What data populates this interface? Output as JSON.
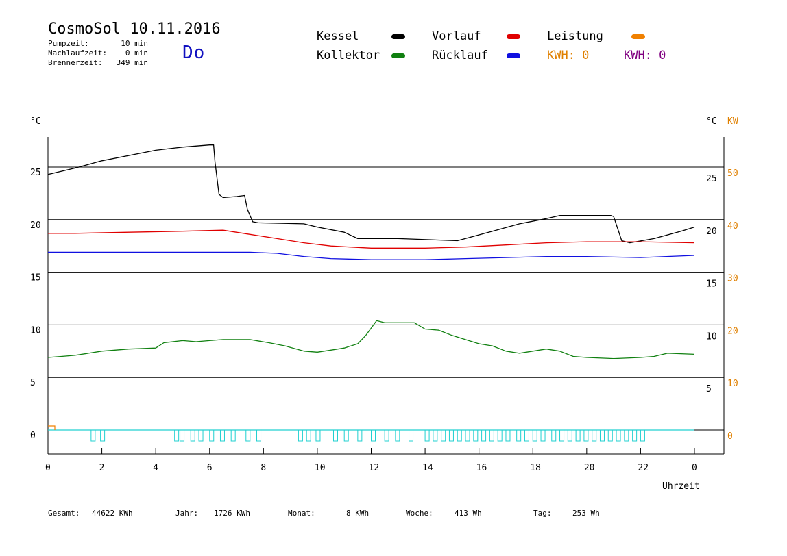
{
  "header": {
    "title": "CosmoSol 10.11.2016",
    "weekday": "Do",
    "stats": [
      {
        "label": "Pumpzeit:",
        "value": "10 min"
      },
      {
        "label": "Nachlaufzeit:",
        "value": "0 min"
      },
      {
        "label": "Brennerzeit:",
        "value": "349 min"
      }
    ]
  },
  "legend": {
    "kessel": {
      "label": "Kessel",
      "color": "#000000"
    },
    "vorlauf": {
      "label": "Vorlauf",
      "color": "#e00000"
    },
    "leistung": {
      "label": "Leistung",
      "color": "#f08000"
    },
    "kollektor": {
      "label": "Kollektor",
      "color": "#108010"
    },
    "ruecklauf": {
      "label": "Rücklauf",
      "color": "#1010e0"
    },
    "kwh1": {
      "label": "KWH: 0",
      "color": "#e08000"
    },
    "kwh2": {
      "label": "KWH: 0",
      "color": "#800080"
    }
  },
  "footer": [
    {
      "label": "Gesamt:",
      "value": "44622 KWh"
    },
    {
      "label": "Jahr:",
      "value": "1726 KWh"
    },
    {
      "label": "Monat:",
      "value": "8 KWh"
    },
    {
      "label": "Woche:",
      "value": "413 Wh"
    },
    {
      "label": "Tag:",
      "value": "253 Wh"
    }
  ],
  "chart_data": {
    "type": "line",
    "xlabel": "Uhrzeit",
    "x_ticks": [
      "0",
      "2",
      "4",
      "6",
      "8",
      "10",
      "12",
      "14",
      "16",
      "18",
      "20",
      "22",
      "0"
    ],
    "xlim": [
      0,
      24
    ],
    "left_axis": {
      "unit": "°C",
      "ticks": [
        0,
        5,
        10,
        15,
        20,
        25
      ],
      "ylim": [
        -2,
        28
      ]
    },
    "right_axis_temp": {
      "unit": "°C",
      "ticks": [
        5,
        10,
        15,
        20,
        25
      ]
    },
    "right_axis_power": {
      "unit": "KW",
      "ticks": [
        0,
        10,
        20,
        30,
        40,
        50
      ],
      "color": "#e08000"
    },
    "grid": "horizontal",
    "series": [
      {
        "name": "Kessel",
        "color": "#000000",
        "points": [
          [
            0,
            24.3
          ],
          [
            1,
            24.9
          ],
          [
            2,
            25.6
          ],
          [
            3,
            26.1
          ],
          [
            4,
            26.6
          ],
          [
            5,
            26.9
          ],
          [
            6,
            27.1
          ],
          [
            6.15,
            27.1
          ],
          [
            6.2,
            25.5
          ],
          [
            6.35,
            22.4
          ],
          [
            6.5,
            22.1
          ],
          [
            7.0,
            22.2
          ],
          [
            7.3,
            22.3
          ],
          [
            7.4,
            21.0
          ],
          [
            7.6,
            19.8
          ],
          [
            7.8,
            19.7
          ],
          [
            9.5,
            19.6
          ],
          [
            10.0,
            19.3
          ],
          [
            11.0,
            18.8
          ],
          [
            11.5,
            18.2
          ],
          [
            13.0,
            18.2
          ],
          [
            15.2,
            18.0
          ],
          [
            16.5,
            18.9
          ],
          [
            17.5,
            19.6
          ],
          [
            18.5,
            20.1
          ],
          [
            19.0,
            20.4
          ],
          [
            20.9,
            20.4
          ],
          [
            21.0,
            20.3
          ],
          [
            21.3,
            18.0
          ],
          [
            21.6,
            17.8
          ],
          [
            22.5,
            18.2
          ],
          [
            23.5,
            18.9
          ],
          [
            24,
            19.3
          ]
        ]
      },
      {
        "name": "Vorlauf",
        "color": "#e00000",
        "points": [
          [
            0,
            18.7
          ],
          [
            1,
            18.7
          ],
          [
            3,
            18.8
          ],
          [
            5,
            18.9
          ],
          [
            6.5,
            19.0
          ],
          [
            7.5,
            18.6
          ],
          [
            8.5,
            18.2
          ],
          [
            9.5,
            17.8
          ],
          [
            10.5,
            17.5
          ],
          [
            12,
            17.3
          ],
          [
            14,
            17.3
          ],
          [
            15.5,
            17.4
          ],
          [
            17,
            17.6
          ],
          [
            18.5,
            17.8
          ],
          [
            20,
            17.9
          ],
          [
            22,
            17.9
          ],
          [
            24,
            17.8
          ]
        ]
      },
      {
        "name": "Rücklauf",
        "color": "#1010e0",
        "points": [
          [
            0,
            16.9
          ],
          [
            2,
            16.9
          ],
          [
            4,
            16.9
          ],
          [
            6,
            16.9
          ],
          [
            7.5,
            16.9
          ],
          [
            8.5,
            16.8
          ],
          [
            9.5,
            16.5
          ],
          [
            10.5,
            16.3
          ],
          [
            12,
            16.2
          ],
          [
            14,
            16.2
          ],
          [
            15.5,
            16.3
          ],
          [
            17,
            16.4
          ],
          [
            18.5,
            16.5
          ],
          [
            20,
            16.5
          ],
          [
            22,
            16.4
          ],
          [
            24,
            16.6
          ]
        ]
      },
      {
        "name": "Kollektor",
        "color": "#108010",
        "points": [
          [
            0,
            6.9
          ],
          [
            0.5,
            7.0
          ],
          [
            1,
            7.1
          ],
          [
            1.5,
            7.3
          ],
          [
            2,
            7.5
          ],
          [
            3,
            7.7
          ],
          [
            4,
            7.8
          ],
          [
            4.3,
            8.3
          ],
          [
            5,
            8.5
          ],
          [
            5.5,
            8.4
          ],
          [
            6,
            8.5
          ],
          [
            6.5,
            8.6
          ],
          [
            7,
            8.6
          ],
          [
            7.5,
            8.6
          ],
          [
            8.2,
            8.3
          ],
          [
            8.8,
            8.0
          ],
          [
            9.5,
            7.5
          ],
          [
            10,
            7.4
          ],
          [
            10.5,
            7.6
          ],
          [
            11,
            7.8
          ],
          [
            11.5,
            8.2
          ],
          [
            11.8,
            9.0
          ],
          [
            12.2,
            10.4
          ],
          [
            12.5,
            10.2
          ],
          [
            13,
            10.2
          ],
          [
            13.6,
            10.2
          ],
          [
            14,
            9.6
          ],
          [
            14.5,
            9.5
          ],
          [
            15,
            9.0
          ],
          [
            15.5,
            8.6
          ],
          [
            16,
            8.2
          ],
          [
            16.5,
            8.0
          ],
          [
            17,
            7.5
          ],
          [
            17.5,
            7.3
          ],
          [
            18,
            7.5
          ],
          [
            18.5,
            7.7
          ],
          [
            19,
            7.5
          ],
          [
            19.5,
            7.0
          ],
          [
            20,
            6.9
          ],
          [
            21,
            6.8
          ],
          [
            22,
            6.9
          ],
          [
            22.5,
            7.0
          ],
          [
            23,
            7.3
          ],
          [
            24,
            7.2
          ]
        ]
      }
    ],
    "burner_pulses_h": [
      1.6,
      1.95,
      4.7,
      4.9,
      5.3,
      5.6,
      6.0,
      6.4,
      6.8,
      7.35,
      7.75,
      9.3,
      9.6,
      9.95,
      10.6,
      11.0,
      11.5,
      12.0,
      12.5,
      12.9,
      13.4,
      14.0,
      14.3,
      14.6,
      14.9,
      15.2,
      15.5,
      15.8,
      16.1,
      16.4,
      16.7,
      17.0,
      17.4,
      17.7,
      18.0,
      18.3,
      18.7,
      19.0,
      19.3,
      19.6,
      19.9,
      20.2,
      20.5,
      20.8,
      21.1,
      21.4,
      21.7,
      22.0
    ],
    "burner_color": "#20d0d0"
  }
}
